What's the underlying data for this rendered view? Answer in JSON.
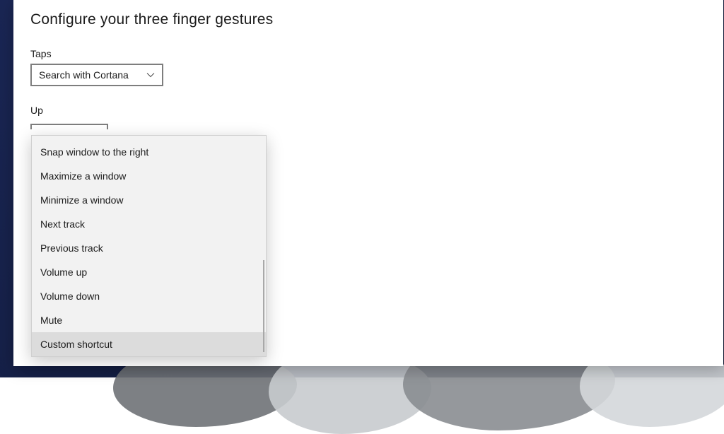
{
  "title": "Configure your three finger gestures",
  "fields": {
    "taps": {
      "label": "Taps",
      "value": "Search with Cortana"
    },
    "up": {
      "label": "Up",
      "value": ""
    }
  },
  "dropdown": {
    "options": [
      {
        "label": "Snap window to the right",
        "selected": false
      },
      {
        "label": "Maximize a window",
        "selected": false
      },
      {
        "label": "Minimize a window",
        "selected": false
      },
      {
        "label": "Next track",
        "selected": false
      },
      {
        "label": "Previous track",
        "selected": false
      },
      {
        "label": "Volume up",
        "selected": false
      },
      {
        "label": "Volume down",
        "selected": false
      },
      {
        "label": "Mute",
        "selected": false
      },
      {
        "label": "Custom shortcut",
        "selected": true
      }
    ]
  }
}
